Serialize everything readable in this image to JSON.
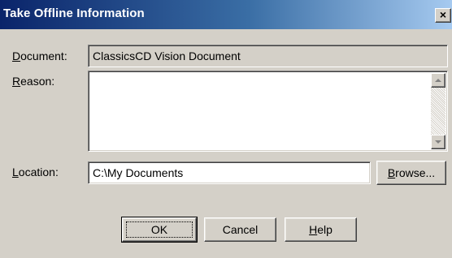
{
  "window": {
    "title": "Take Offline Information",
    "close_glyph": "×"
  },
  "document": {
    "label_mnemonic": "D",
    "label_rest": "ocument:",
    "value": "ClassicsCD Vision Document"
  },
  "reason": {
    "label_mnemonic": "R",
    "label_rest": "eason:",
    "value": ""
  },
  "location": {
    "label_mnemonic": "L",
    "label_rest": "ocation:",
    "value": "C:\\My Documents"
  },
  "buttons": {
    "browse_mnemonic": "B",
    "browse_rest": "rowse...",
    "ok": "OK",
    "cancel": "Cancel",
    "help_mnemonic": "H",
    "help_rest": "elp"
  },
  "colors": {
    "titlebar_start": "#0a246a",
    "titlebar_end": "#a6caf0",
    "face": "#d4d0c8"
  },
  "icons": {
    "close": "close-icon",
    "scroll_up": "scroll-up-arrow-icon",
    "scroll_down": "scroll-down-arrow-icon"
  }
}
